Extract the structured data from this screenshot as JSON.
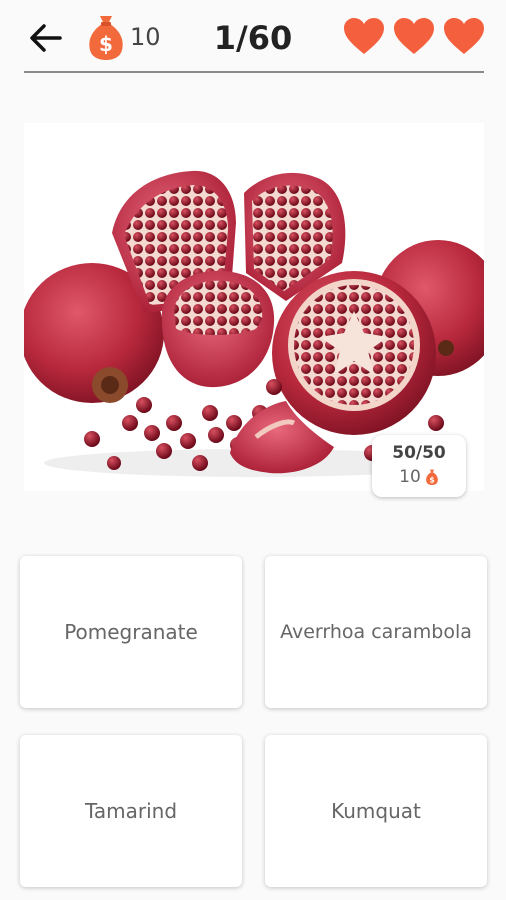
{
  "header": {
    "coins": "10",
    "progress": "1/60",
    "lives": 3
  },
  "question": {
    "image": "pomegranate-photo",
    "score": "50/50",
    "reward": "10"
  },
  "answers": [
    "Pomegranate",
    "Averrhoa carambola",
    "Tamarind",
    "Kumquat"
  ],
  "colors": {
    "heart": "#f4603e",
    "bag": "#f26a3c"
  }
}
